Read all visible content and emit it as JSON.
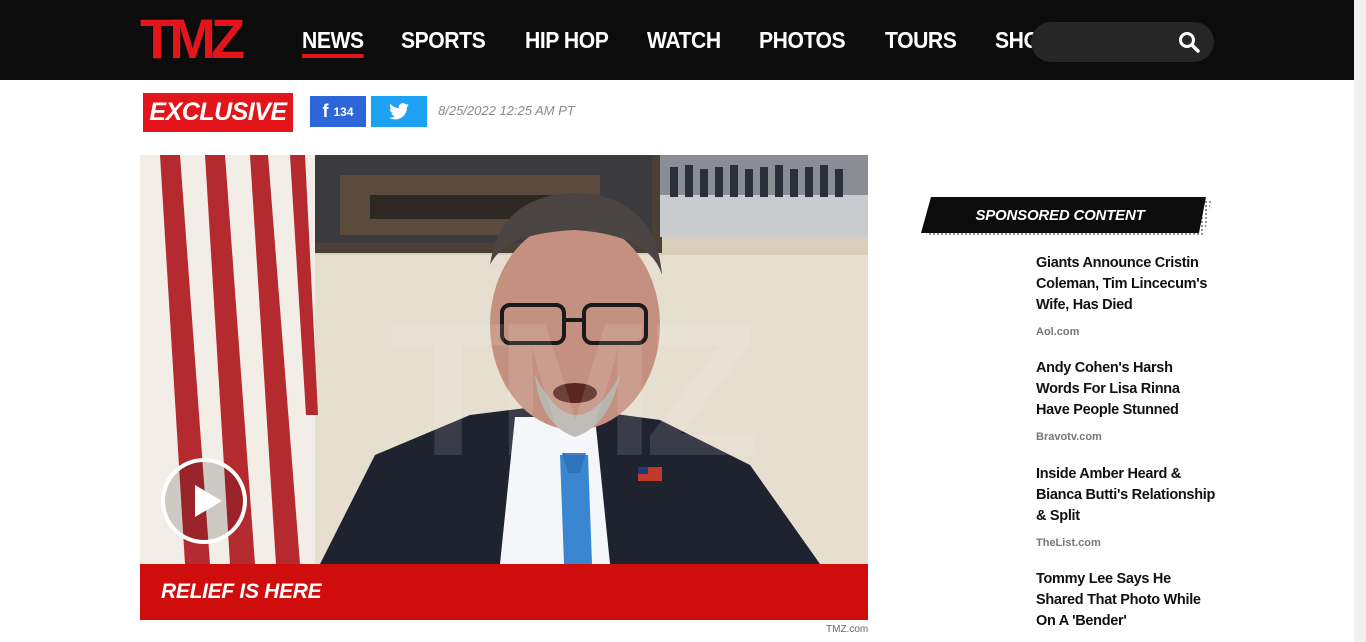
{
  "header": {
    "logo_text": "TMZ",
    "nav": [
      {
        "label": "NEWS",
        "active": true
      },
      {
        "label": "SPORTS",
        "active": false
      },
      {
        "label": "HIP HOP",
        "active": false
      },
      {
        "label": "WATCH",
        "active": false
      },
      {
        "label": "PHOTOS",
        "active": false
      },
      {
        "label": "TOURS",
        "active": false
      },
      {
        "label": "SHOP",
        "active": false
      }
    ],
    "search_placeholder": ""
  },
  "article": {
    "badge": "EXCLUSIVE",
    "facebook_count": "134",
    "timestamp": "8/25/2022 12:25 AM PT",
    "video_caption": "RELIEF IS HERE",
    "video_credit": "TMZ.com"
  },
  "sponsored": {
    "title": "SPONSORED CONTENT",
    "items": [
      {
        "title": "Giants Announce Cristin Coleman, Tim Lincecum's Wife, Has Died",
        "source": "Aol.com"
      },
      {
        "title": "Andy Cohen's Harsh Words For Lisa Rinna Have People Stunned",
        "source": "Bravotv.com"
      },
      {
        "title": "Inside Amber Heard & Bianca Butti's Relationship & Split",
        "source": "TheList.com"
      },
      {
        "title": "Tommy Lee Says He Shared That Photo While On A 'Bender'",
        "source": ""
      }
    ]
  },
  "colors": {
    "brand_red": "#e3151a",
    "facebook_blue": "#2d66d9",
    "twitter_blue": "#1da1f2",
    "header_bg": "#0c0c0c"
  },
  "icons": [
    "search-icon",
    "facebook-icon",
    "twitter-icon",
    "play-icon"
  ]
}
